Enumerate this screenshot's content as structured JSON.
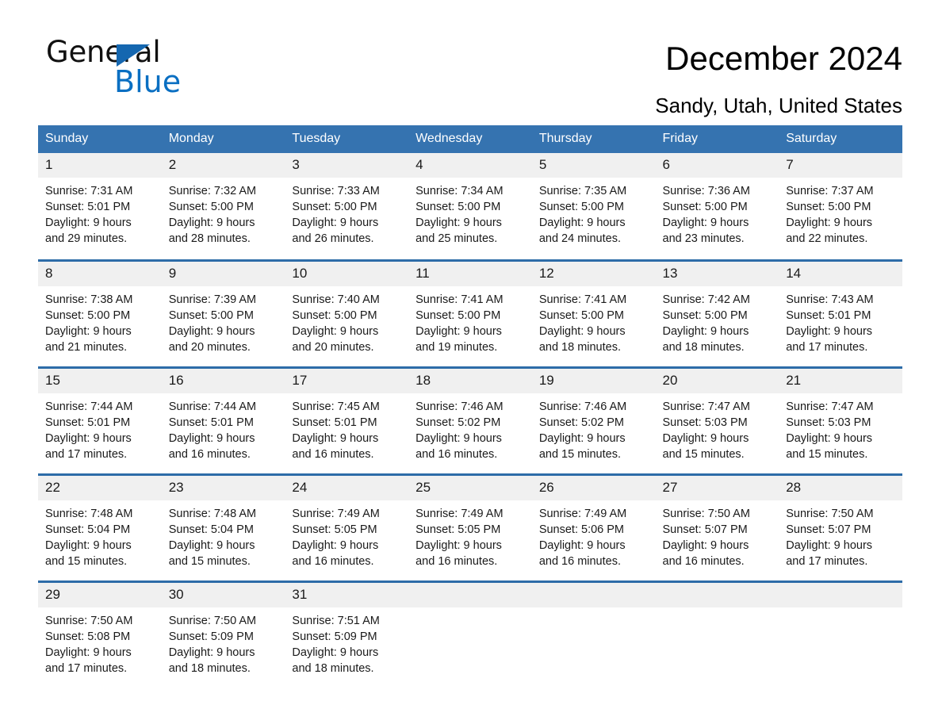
{
  "brand": {
    "name_part1": "General",
    "name_part2": "Blue",
    "triangle_color": "#1567b0",
    "blue_color": "#0a6fc2"
  },
  "header": {
    "title": "December 2024",
    "subtitle": "Sandy, Utah, United States"
  },
  "theme": {
    "header_blue": "#3573b0",
    "row_divider_blue": "#2d6ca8",
    "daynum_band": "#f0f0f0"
  },
  "calendar": {
    "weekday_headers": [
      "Sunday",
      "Monday",
      "Tuesday",
      "Wednesday",
      "Thursday",
      "Friday",
      "Saturday"
    ],
    "weeks": [
      [
        {
          "day": "1",
          "sunrise": "Sunrise: 7:31 AM",
          "sunset": "Sunset: 5:01 PM",
          "daylight1": "Daylight: 9 hours",
          "daylight2": "and 29 minutes."
        },
        {
          "day": "2",
          "sunrise": "Sunrise: 7:32 AM",
          "sunset": "Sunset: 5:00 PM",
          "daylight1": "Daylight: 9 hours",
          "daylight2": "and 28 minutes."
        },
        {
          "day": "3",
          "sunrise": "Sunrise: 7:33 AM",
          "sunset": "Sunset: 5:00 PM",
          "daylight1": "Daylight: 9 hours",
          "daylight2": "and 26 minutes."
        },
        {
          "day": "4",
          "sunrise": "Sunrise: 7:34 AM",
          "sunset": "Sunset: 5:00 PM",
          "daylight1": "Daylight: 9 hours",
          "daylight2": "and 25 minutes."
        },
        {
          "day": "5",
          "sunrise": "Sunrise: 7:35 AM",
          "sunset": "Sunset: 5:00 PM",
          "daylight1": "Daylight: 9 hours",
          "daylight2": "and 24 minutes."
        },
        {
          "day": "6",
          "sunrise": "Sunrise: 7:36 AM",
          "sunset": "Sunset: 5:00 PM",
          "daylight1": "Daylight: 9 hours",
          "daylight2": "and 23 minutes."
        },
        {
          "day": "7",
          "sunrise": "Sunrise: 7:37 AM",
          "sunset": "Sunset: 5:00 PM",
          "daylight1": "Daylight: 9 hours",
          "daylight2": "and 22 minutes."
        }
      ],
      [
        {
          "day": "8",
          "sunrise": "Sunrise: 7:38 AM",
          "sunset": "Sunset: 5:00 PM",
          "daylight1": "Daylight: 9 hours",
          "daylight2": "and 21 minutes."
        },
        {
          "day": "9",
          "sunrise": "Sunrise: 7:39 AM",
          "sunset": "Sunset: 5:00 PM",
          "daylight1": "Daylight: 9 hours",
          "daylight2": "and 20 minutes."
        },
        {
          "day": "10",
          "sunrise": "Sunrise: 7:40 AM",
          "sunset": "Sunset: 5:00 PM",
          "daylight1": "Daylight: 9 hours",
          "daylight2": "and 20 minutes."
        },
        {
          "day": "11",
          "sunrise": "Sunrise: 7:41 AM",
          "sunset": "Sunset: 5:00 PM",
          "daylight1": "Daylight: 9 hours",
          "daylight2": "and 19 minutes."
        },
        {
          "day": "12",
          "sunrise": "Sunrise: 7:41 AM",
          "sunset": "Sunset: 5:00 PM",
          "daylight1": "Daylight: 9 hours",
          "daylight2": "and 18 minutes."
        },
        {
          "day": "13",
          "sunrise": "Sunrise: 7:42 AM",
          "sunset": "Sunset: 5:00 PM",
          "daylight1": "Daylight: 9 hours",
          "daylight2": "and 18 minutes."
        },
        {
          "day": "14",
          "sunrise": "Sunrise: 7:43 AM",
          "sunset": "Sunset: 5:01 PM",
          "daylight1": "Daylight: 9 hours",
          "daylight2": "and 17 minutes."
        }
      ],
      [
        {
          "day": "15",
          "sunrise": "Sunrise: 7:44 AM",
          "sunset": "Sunset: 5:01 PM",
          "daylight1": "Daylight: 9 hours",
          "daylight2": "and 17 minutes."
        },
        {
          "day": "16",
          "sunrise": "Sunrise: 7:44 AM",
          "sunset": "Sunset: 5:01 PM",
          "daylight1": "Daylight: 9 hours",
          "daylight2": "and 16 minutes."
        },
        {
          "day": "17",
          "sunrise": "Sunrise: 7:45 AM",
          "sunset": "Sunset: 5:01 PM",
          "daylight1": "Daylight: 9 hours",
          "daylight2": "and 16 minutes."
        },
        {
          "day": "18",
          "sunrise": "Sunrise: 7:46 AM",
          "sunset": "Sunset: 5:02 PM",
          "daylight1": "Daylight: 9 hours",
          "daylight2": "and 16 minutes."
        },
        {
          "day": "19",
          "sunrise": "Sunrise: 7:46 AM",
          "sunset": "Sunset: 5:02 PM",
          "daylight1": "Daylight: 9 hours",
          "daylight2": "and 15 minutes."
        },
        {
          "day": "20",
          "sunrise": "Sunrise: 7:47 AM",
          "sunset": "Sunset: 5:03 PM",
          "daylight1": "Daylight: 9 hours",
          "daylight2": "and 15 minutes."
        },
        {
          "day": "21",
          "sunrise": "Sunrise: 7:47 AM",
          "sunset": "Sunset: 5:03 PM",
          "daylight1": "Daylight: 9 hours",
          "daylight2": "and 15 minutes."
        }
      ],
      [
        {
          "day": "22",
          "sunrise": "Sunrise: 7:48 AM",
          "sunset": "Sunset: 5:04 PM",
          "daylight1": "Daylight: 9 hours",
          "daylight2": "and 15 minutes."
        },
        {
          "day": "23",
          "sunrise": "Sunrise: 7:48 AM",
          "sunset": "Sunset: 5:04 PM",
          "daylight1": "Daylight: 9 hours",
          "daylight2": "and 15 minutes."
        },
        {
          "day": "24",
          "sunrise": "Sunrise: 7:49 AM",
          "sunset": "Sunset: 5:05 PM",
          "daylight1": "Daylight: 9 hours",
          "daylight2": "and 16 minutes."
        },
        {
          "day": "25",
          "sunrise": "Sunrise: 7:49 AM",
          "sunset": "Sunset: 5:05 PM",
          "daylight1": "Daylight: 9 hours",
          "daylight2": "and 16 minutes."
        },
        {
          "day": "26",
          "sunrise": "Sunrise: 7:49 AM",
          "sunset": "Sunset: 5:06 PM",
          "daylight1": "Daylight: 9 hours",
          "daylight2": "and 16 minutes."
        },
        {
          "day": "27",
          "sunrise": "Sunrise: 7:50 AM",
          "sunset": "Sunset: 5:07 PM",
          "daylight1": "Daylight: 9 hours",
          "daylight2": "and 16 minutes."
        },
        {
          "day": "28",
          "sunrise": "Sunrise: 7:50 AM",
          "sunset": "Sunset: 5:07 PM",
          "daylight1": "Daylight: 9 hours",
          "daylight2": "and 17 minutes."
        }
      ],
      [
        {
          "day": "29",
          "sunrise": "Sunrise: 7:50 AM",
          "sunset": "Sunset: 5:08 PM",
          "daylight1": "Daylight: 9 hours",
          "daylight2": "and 17 minutes."
        },
        {
          "day": "30",
          "sunrise": "Sunrise: 7:50 AM",
          "sunset": "Sunset: 5:09 PM",
          "daylight1": "Daylight: 9 hours",
          "daylight2": "and 18 minutes."
        },
        {
          "day": "31",
          "sunrise": "Sunrise: 7:51 AM",
          "sunset": "Sunset: 5:09 PM",
          "daylight1": "Daylight: 9 hours",
          "daylight2": "and 18 minutes."
        },
        {
          "day": "",
          "sunrise": "",
          "sunset": "",
          "daylight1": "",
          "daylight2": ""
        },
        {
          "day": "",
          "sunrise": "",
          "sunset": "",
          "daylight1": "",
          "daylight2": ""
        },
        {
          "day": "",
          "sunrise": "",
          "sunset": "",
          "daylight1": "",
          "daylight2": ""
        },
        {
          "day": "",
          "sunrise": "",
          "sunset": "",
          "daylight1": "",
          "daylight2": ""
        }
      ]
    ]
  }
}
